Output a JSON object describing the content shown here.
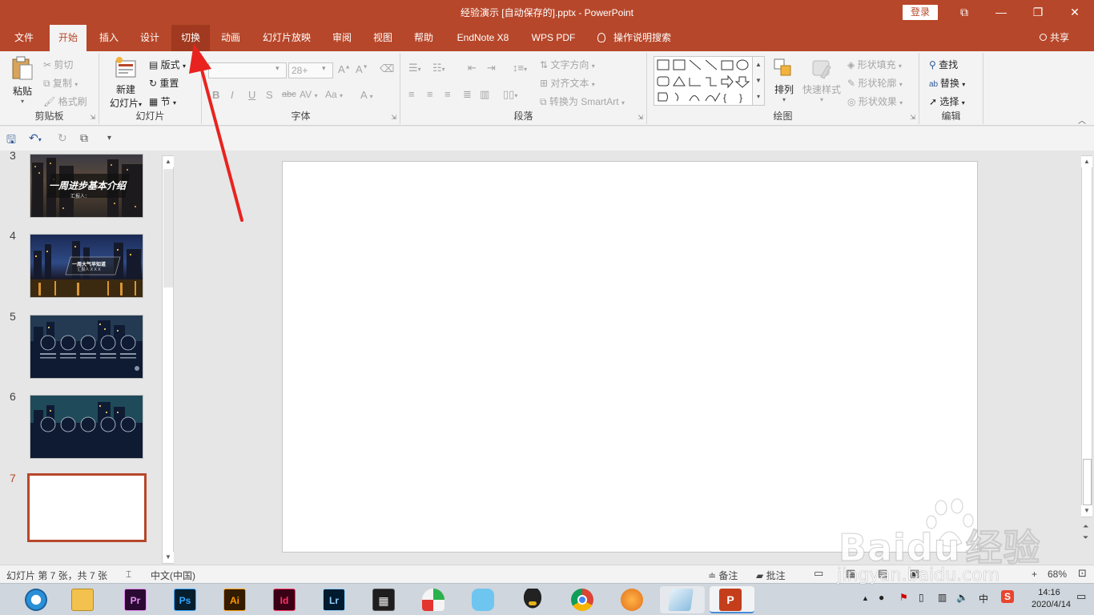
{
  "window": {
    "title": "经验演示 [自动保存的].pptx  -  PowerPoint",
    "login": "登录",
    "controls": {
      "ribbon_display": "⧉",
      "minimize": "—",
      "restore": "❐",
      "close": "✕"
    }
  },
  "tabs": [
    "文件",
    "开始",
    "插入",
    "设计",
    "切换",
    "动画",
    "幻灯片放映",
    "审阅",
    "视图",
    "帮助",
    "EndNote X8",
    "WPS PDF"
  ],
  "active_tab": "开始",
  "tell_me": "操作说明搜索",
  "share": "共享",
  "ribbon": {
    "clipboard": {
      "label": "剪贴板",
      "paste": "粘贴",
      "cut": "剪切",
      "copy": "复制",
      "format_painter": "格式刷"
    },
    "slides": {
      "label": "幻灯片",
      "new_slide_1": "新建",
      "new_slide_2": "幻灯片",
      "layout": "版式",
      "reset": "重置",
      "section": "节"
    },
    "font": {
      "label": "字体",
      "font_name": "",
      "font_size": "28+",
      "bold": "B",
      "italic": "I",
      "underline": "U",
      "shadow": "S",
      "strike": "abc",
      "spacing": "AV",
      "case": "Aa",
      "color": "A"
    },
    "paragraph": {
      "label": "段落",
      "text_direction": "文字方向",
      "align_text": "对齐文本",
      "smartart": "转换为 SmartArt"
    },
    "drawing": {
      "label": "绘图",
      "arrange": "排列",
      "quick_styles": "快速样式",
      "shape_fill": "形状填充",
      "shape_outline": "形状轮廓",
      "shape_effects": "形状效果"
    },
    "editing": {
      "label": "编辑",
      "find": "查找",
      "replace": "替换",
      "select": "选择"
    }
  },
  "thumbnails": [
    {
      "num": "3",
      "title": "一周进步基本介绍",
      "subtitle": "汇报人："
    },
    {
      "num": "4",
      "title": "一周大气早知道",
      "subtitle": "汇报人 X X X"
    },
    {
      "num": "5"
    },
    {
      "num": "6"
    },
    {
      "num": "7"
    }
  ],
  "selected_slide": "7",
  "status": {
    "slide_info": "幻灯片 第 7 张，共 7 张",
    "language": "中文(中国)",
    "notes": "备注",
    "comments": "批注",
    "zoom": "68%"
  },
  "taskbar": {
    "apps": [
      "Pr",
      "Ps",
      "Ai",
      "Id",
      "Lr"
    ],
    "ime": "中",
    "time": "14:16",
    "date": "2020/4/14"
  },
  "watermark": {
    "logo": "Baidu",
    "brand": "经验",
    "url": "jingyan.baidu.com"
  },
  "colors": {
    "accent": "#b7472a",
    "ribbon_bg": "#f3f3f3",
    "workspace": "#e6e6e6",
    "arrow": "#e8231f"
  }
}
